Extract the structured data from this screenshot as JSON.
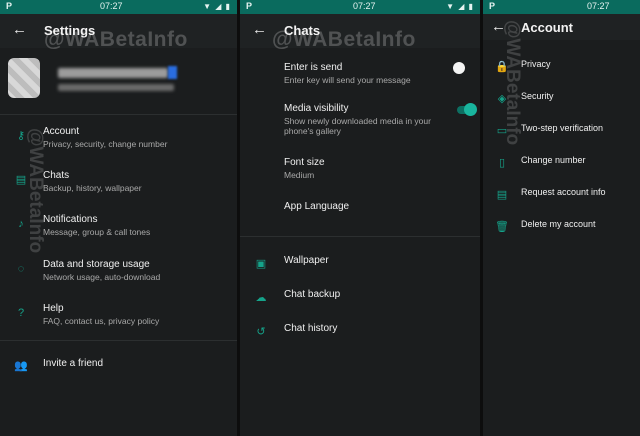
{
  "status": {
    "carrier_glyph": "P",
    "time": "07:27",
    "icons": "▼ ◢ ▮"
  },
  "watermark": "@WABetaInfo",
  "settings": {
    "title": "Settings",
    "items": [
      {
        "label": "Account",
        "sub": "Privacy, security, change number",
        "icon": "key-icon"
      },
      {
        "label": "Chats",
        "sub": "Backup, history, wallpaper",
        "icon": "chat-icon"
      },
      {
        "label": "Notifications",
        "sub": "Message, group & call tones",
        "icon": "bell-icon"
      },
      {
        "label": "Data and storage usage",
        "sub": "Network usage, auto-download",
        "icon": "data-usage-icon"
      },
      {
        "label": "Help",
        "sub": "FAQ, contact us, privacy policy",
        "icon": "help-icon"
      }
    ],
    "invite": {
      "label": "Invite a friend",
      "icon": "people-icon"
    }
  },
  "chats": {
    "title": "Chats",
    "enter_is_send": {
      "label": "Enter is send",
      "sub": "Enter key will send your message",
      "enabled": false
    },
    "media_visibility": {
      "label": "Media visibility",
      "sub1": "Show newly downloaded media in your",
      "sub2": "phone's gallery",
      "enabled": true
    },
    "font_size": {
      "label": "Font size",
      "sub": "Medium"
    },
    "app_language": {
      "label": "App Language"
    },
    "wallpaper": {
      "label": "Wallpaper",
      "icon": "wallpaper-icon"
    },
    "chat_backup": {
      "label": "Chat backup",
      "icon": "cloud-upload-icon"
    },
    "chat_history": {
      "label": "Chat history",
      "icon": "history-icon"
    }
  },
  "account": {
    "title": "Account",
    "items": [
      {
        "label": "Privacy",
        "icon": "lock-icon"
      },
      {
        "label": "Security",
        "icon": "shield-icon"
      },
      {
        "label": "Two-step verification",
        "icon": "dots-icon"
      },
      {
        "label": "Change number",
        "icon": "phone-icon"
      },
      {
        "label": "Request account info",
        "icon": "document-icon"
      },
      {
        "label": "Delete my account",
        "icon": "trash-icon"
      }
    ]
  },
  "colors": {
    "accent": "#15a38a",
    "statusbar": "#0a6b5e",
    "background": "#1b1d1e"
  }
}
